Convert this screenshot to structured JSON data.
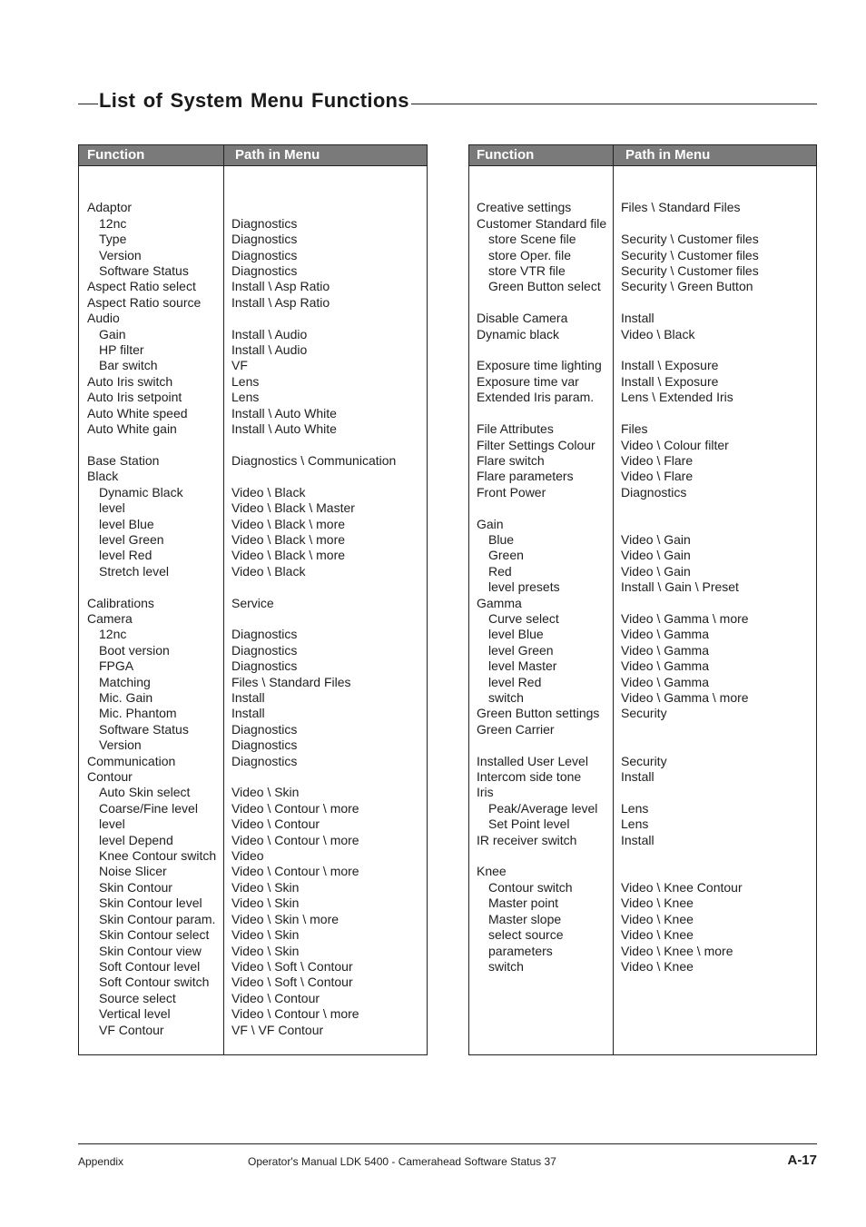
{
  "page": {
    "title": "List of System Menu Functions",
    "footer": {
      "section": "Appendix",
      "manual": "Operator's Manual LDK 5400 - Camerahead Software Status 37",
      "page_number": "A-17"
    }
  },
  "tables": [
    {
      "headers": {
        "function": "Function",
        "path": "Path in Menu"
      },
      "rows": [
        {
          "fn": "",
          "path": "",
          "sub": false
        },
        {
          "fn": "Adaptor",
          "path": "",
          "sub": false
        },
        {
          "fn": "12nc",
          "path": "Diagnostics",
          "sub": true
        },
        {
          "fn": "Type",
          "path": "Diagnostics",
          "sub": true
        },
        {
          "fn": "Version",
          "path": "Diagnostics",
          "sub": true
        },
        {
          "fn": "Software Status",
          "path": "Diagnostics",
          "sub": true
        },
        {
          "fn": "Aspect Ratio select",
          "path": "Install \\  Asp Ratio",
          "sub": false
        },
        {
          "fn": "Aspect Ratio source",
          "path": "Install \\  Asp Ratio",
          "sub": false
        },
        {
          "fn": "Audio",
          "path": "",
          "sub": false
        },
        {
          "fn": "Gain",
          "path": "Install \\ Audio",
          "sub": true
        },
        {
          "fn": "HP filter",
          "path": "Install \\ Audio",
          "sub": true
        },
        {
          "fn": "Bar switch",
          "path": "VF",
          "sub": true
        },
        {
          "fn": "Auto Iris switch",
          "path": "Lens",
          "sub": false
        },
        {
          "fn": "Auto Iris setpoint",
          "path": "Lens",
          "sub": false
        },
        {
          "fn": "Auto White speed",
          "path": "Install \\ Auto White",
          "sub": false
        },
        {
          "fn": "Auto White gain",
          "path": "Install \\ Auto White",
          "sub": false
        },
        {
          "fn": "",
          "path": "",
          "sub": false
        },
        {
          "fn": "Base Station",
          "path": "Diagnostics \\ Communication",
          "sub": false
        },
        {
          "fn": "Black",
          "path": "",
          "sub": false
        },
        {
          "fn": "Dynamic Black",
          "path": "Video \\ Black",
          "sub": true
        },
        {
          "fn": "level",
          "path": "Video \\ Black \\ Master",
          "sub": true
        },
        {
          "fn": "level  Blue",
          "path": "Video \\ Black \\ more",
          "sub": true
        },
        {
          "fn": "level  Green",
          "path": "Video \\ Black \\ more",
          "sub": true
        },
        {
          "fn": "level  Red",
          "path": "Video \\ Black \\ more",
          "sub": true
        },
        {
          "fn": "Stretch level",
          "path": "Video \\ Black",
          "sub": true
        },
        {
          "fn": "",
          "path": "",
          "sub": false
        },
        {
          "fn": "Calibrations",
          "path": "Service",
          "sub": false
        },
        {
          "fn": "Camera",
          "path": "",
          "sub": false
        },
        {
          "fn": "12nc",
          "path": "Diagnostics",
          "sub": true
        },
        {
          "fn": "Boot version",
          "path": "Diagnostics",
          "sub": true
        },
        {
          "fn": "FPGA",
          "path": "Diagnostics",
          "sub": true
        },
        {
          "fn": "Matching",
          "path": "Files \\ Standard Files",
          "sub": true
        },
        {
          "fn": "Mic. Gain",
          "path": "Install",
          "sub": true
        },
        {
          "fn": "Mic. Phantom",
          "path": "Install",
          "sub": true
        },
        {
          "fn": "Software Status",
          "path": "Diagnostics",
          "sub": true
        },
        {
          "fn": "Version",
          "path": "Diagnostics",
          "sub": true
        },
        {
          "fn": "Communication",
          "path": "Diagnostics",
          "sub": false
        },
        {
          "fn": "Contour",
          "path": "",
          "sub": false
        },
        {
          "fn": "Auto Skin select",
          "path": "Video \\ Skin",
          "sub": true
        },
        {
          "fn": "Coarse/Fine  level",
          "path": "Video \\ Contour \\ more",
          "sub": true
        },
        {
          "fn": "level",
          "path": "Video \\ Contour",
          "sub": true
        },
        {
          "fn": "level  Depend",
          "path": "Video \\ Contour \\ more",
          "sub": true
        },
        {
          "fn": "Knee Contour switch",
          "path": "Video",
          "sub": true
        },
        {
          "fn": "Noise  Slicer",
          "path": "Video \\ Contour \\ more",
          "sub": true
        },
        {
          "fn": "Skin  Contour",
          "path": "Video \\ Skin",
          "sub": true
        },
        {
          "fn": "Skin Contour level",
          "path": "Video \\ Skin",
          "sub": true
        },
        {
          "fn": "Skin Contour param.",
          "path": "Video \\ Skin \\ more",
          "sub": true
        },
        {
          "fn": "Skin Contour select",
          "path": "Video \\ Skin",
          "sub": true
        },
        {
          "fn": "Skin Contour view",
          "path": "Video \\ Skin",
          "sub": true
        },
        {
          "fn": "Soft Contour level",
          "path": "Video \\ Soft \\ Contour",
          "sub": true
        },
        {
          "fn": "Soft Contour switch",
          "path": "Video \\ Soft \\ Contour",
          "sub": true
        },
        {
          "fn": "Source select",
          "path": "Video \\ Contour",
          "sub": true
        },
        {
          "fn": "Vertical  level",
          "path": "Video \\ Contour \\ more",
          "sub": true
        },
        {
          "fn": "VF Contour",
          "path": "VF \\ VF Contour",
          "sub": true
        }
      ]
    },
    {
      "headers": {
        "function": "Function",
        "path": "Path in Menu"
      },
      "rows": [
        {
          "fn": "",
          "path": "",
          "sub": false
        },
        {
          "fn": "Creative  settings",
          "path": "Files \\ Standard Files",
          "sub": false
        },
        {
          "fn": "Customer Standard file",
          "path": "",
          "sub": false
        },
        {
          "fn": "store Scene file",
          "path": "Security \\ Customer files",
          "sub": true
        },
        {
          "fn": "store Oper. file",
          "path": "Security \\ Customer files",
          "sub": true
        },
        {
          "fn": "store VTR file",
          "path": "Security \\ Customer files",
          "sub": true
        },
        {
          "fn": "Green Button select",
          "path": "Security \\ Green Button",
          "sub": true
        },
        {
          "fn": "",
          "path": "",
          "sub": false
        },
        {
          "fn": "Disable  Camera",
          "path": "Install",
          "sub": false
        },
        {
          "fn": "Dynamic  black",
          "path": "Video \\ Black",
          "sub": false
        },
        {
          "fn": "",
          "path": "",
          "sub": false
        },
        {
          "fn": "Exposure  time lighting",
          "path": "Install \\ Exposure",
          "sub": false
        },
        {
          "fn": "Exposure  time var",
          "path": "Install \\ Exposure",
          "sub": false
        },
        {
          "fn": "Extended Iris param.",
          "path": "Lens \\ Extended Iris",
          "sub": false
        },
        {
          "fn": "",
          "path": "",
          "sub": false
        },
        {
          "fn": "File Attributes",
          "path": "Files",
          "sub": false
        },
        {
          "fn": "Filter Settings Colour",
          "path": "Video \\ Colour filter",
          "sub": false
        },
        {
          "fn": "Flare  switch",
          "path": "Video \\ Flare",
          "sub": false
        },
        {
          "fn": "Flare  parameters",
          "path": "Video \\ Flare",
          "sub": false
        },
        {
          "fn": "Front Power",
          "path": "Diagnostics",
          "sub": false
        },
        {
          "fn": "",
          "path": "",
          "sub": false
        },
        {
          "fn": "Gain",
          "path": "",
          "sub": false
        },
        {
          "fn": "Blue",
          "path": "Video \\ Gain",
          "sub": true
        },
        {
          "fn": "Green",
          "path": "Video \\ Gain",
          "sub": true
        },
        {
          "fn": "Red",
          "path": "Video \\ Gain",
          "sub": true
        },
        {
          "fn": "level  presets",
          "path": "Install \\ Gain \\ Preset",
          "sub": true
        },
        {
          "fn": "Gamma",
          "path": "",
          "sub": false
        },
        {
          "fn": "Curve  select",
          "path": "Video \\ Gamma \\ more",
          "sub": true
        },
        {
          "fn": "level  Blue",
          "path": "Video \\ Gamma",
          "sub": true
        },
        {
          "fn": "level  Green",
          "path": "Video \\ Gamma",
          "sub": true
        },
        {
          "fn": "level  Master",
          "path": "Video \\ Gamma",
          "sub": true
        },
        {
          "fn": "level  Red",
          "path": "Video \\ Gamma",
          "sub": true
        },
        {
          "fn": "switch",
          "path": "Video \\ Gamma \\ more",
          "sub": true
        },
        {
          "fn": "Green Button settings",
          "path": "Security",
          "sub": false
        },
        {
          "fn": "Green  Carrier",
          "path": "",
          "sub": false
        },
        {
          "fn": "",
          "path": "",
          "sub": false
        },
        {
          "fn": "Installed User Level",
          "path": "Security",
          "sub": false
        },
        {
          "fn": "Intercom side tone",
          "path": "Install",
          "sub": false
        },
        {
          "fn": "Iris",
          "path": "",
          "sub": false
        },
        {
          "fn": "Peak/Average  level",
          "path": "Lens",
          "sub": true
        },
        {
          "fn": "Set Point level",
          "path": "Lens",
          "sub": true
        },
        {
          "fn": "IR receiver switch",
          "path": "Install",
          "sub": false
        },
        {
          "fn": "",
          "path": "",
          "sub": false
        },
        {
          "fn": "Knee",
          "path": "",
          "sub": false
        },
        {
          "fn": "Contour  switch",
          "path": "Video \\ Knee Contour",
          "sub": true
        },
        {
          "fn": "Master point",
          "path": "Video \\ Knee",
          "sub": true
        },
        {
          "fn": "Master slope",
          "path": "Video \\ Knee",
          "sub": true
        },
        {
          "fn": "select source",
          "path": "Video \\ Knee",
          "sub": true
        },
        {
          "fn": "parameters",
          "path": "Video \\ Knee \\ more",
          "sub": true
        },
        {
          "fn": "switch",
          "path": "Video \\ Knee",
          "sub": true
        }
      ]
    }
  ]
}
